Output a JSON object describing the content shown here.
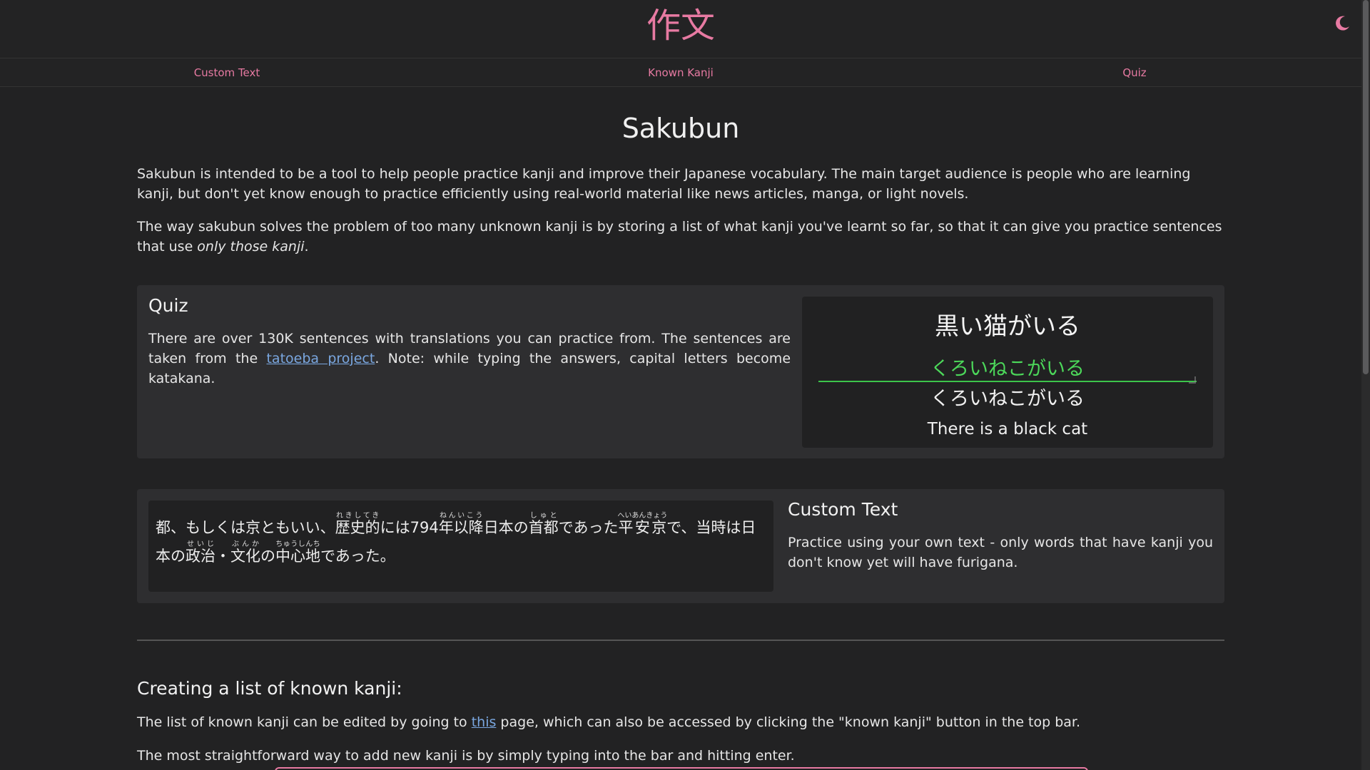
{
  "header": {
    "logo": "作文",
    "theme_toggle_icon": "moon-icon"
  },
  "nav": {
    "items": [
      "Custom Text",
      "Known Kanji",
      "Quiz"
    ]
  },
  "main": {
    "title": "Sakubun",
    "intro_p1": "Sakubun is intended to be a tool to help people practice kanji and improve their Japanese vocabulary. The main target audience is people who are learning kanji, but don't yet know enough to practice efficiently using real-world material like news articles, manga, or light novels.",
    "intro_p2_before": "The way sakubun solves the problem of too many unknown kanji is by storing a list of what kanji you've learnt so far, so that it can give you practice sentences that use ",
    "intro_p2_em": "only those kanji",
    "intro_p2_after": "."
  },
  "quiz_card": {
    "heading": "Quiz",
    "text_before": "There are over 130K sentences with translations you can practice from. The sentences are taken from the ",
    "link": "tatoeba project",
    "text_after": ". Note: while typing the answers, capital letters become katakana.",
    "demo": {
      "sentence": "黒い猫がいる",
      "input_value": "くろいねこがいる",
      "reading": "くろいねこがいる",
      "translation": "There is a black cat"
    }
  },
  "custom_card": {
    "heading": "Custom Text",
    "text": "Practice using your own text - only words that have kanji you don't know yet will have furigana.",
    "furigana": {
      "t1": "都、もしくは京ともいい、",
      "r1_base": "歴史的",
      "r1_rt": "れきしてき",
      "t2": "には794",
      "r2_base": "年以降",
      "r2_rt": "ねんいこう",
      "t3": "日本の",
      "r3_base": "首都",
      "r3_rt": "しゅと",
      "t4": "であった",
      "r4_base": "平安京",
      "r4_rt": "へいあんきょう",
      "t5": "で、当時は日本の",
      "r5_base": "政治",
      "r5_rt": "せいじ",
      "t6": "・",
      "r6_base": "文化",
      "r6_rt": "ぶんか",
      "t7": "の",
      "r7_base": "中心地",
      "r7_rt": "ちゅうしんち",
      "t8": "であった。"
    }
  },
  "known_kanji_section": {
    "heading": "Creating a list of known kanji:",
    "p1_before": "The list of known kanji can be edited by going to ",
    "p1_link": "this",
    "p1_after": " page, which can also be accessed by clicking the \"known kanji\" button in the top bar.",
    "p2": "The most straightforward way to add new kanji is by simply typing into the bar and hitting enter."
  },
  "colors": {
    "accent": "#e77aa2",
    "correct": "#4cd85a",
    "link": "#7aa7e0",
    "background": "#222223"
  }
}
